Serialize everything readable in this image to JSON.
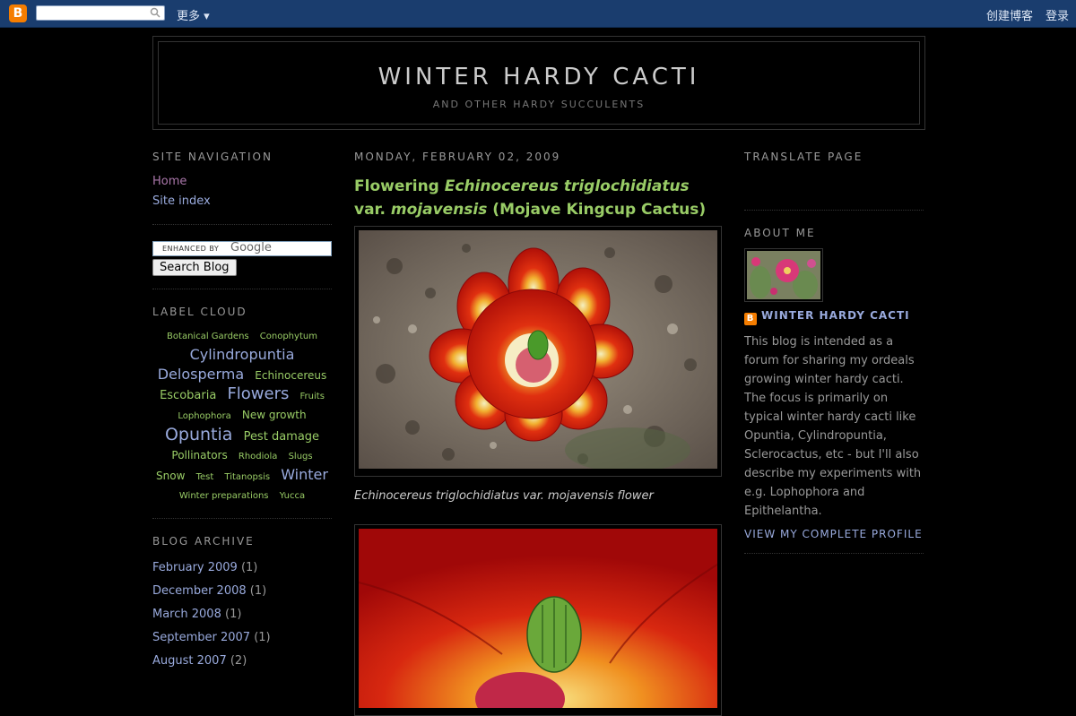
{
  "navbar": {
    "logo_letter": "B",
    "search_value": "",
    "more_label": "更多 ▾",
    "create_blog": "创建博客",
    "sign_in": "登录"
  },
  "header": {
    "title": "WINTER HARDY CACTI",
    "description": "AND OTHER HARDY SUCCULENTS"
  },
  "left": {
    "nav_heading": "SITE NAVIGATION",
    "nav_links": [
      "Home",
      "Site index"
    ],
    "search": {
      "enhanced_by": "ENHANCED BY",
      "google": "Google",
      "button": "Search Blog"
    },
    "cloud_heading": "LABEL CLOUD",
    "cloud": [
      {
        "label": "Botanical Gardens",
        "size": 10
      },
      {
        "label": "Conophytum",
        "size": 10
      },
      {
        "label": "Cylindropuntia",
        "size": 16
      },
      {
        "label": "Delosperma",
        "size": 16
      },
      {
        "label": "Echinocereus",
        "size": 12
      },
      {
        "label": "Escobaria",
        "size": 13
      },
      {
        "label": "Flowers",
        "size": 18
      },
      {
        "label": "Fruits",
        "size": 10
      },
      {
        "label": "Lophophora",
        "size": 10
      },
      {
        "label": "New growth",
        "size": 12
      },
      {
        "label": "Opuntia",
        "size": 19
      },
      {
        "label": "Pest damage",
        "size": 13
      },
      {
        "label": "Pollinators",
        "size": 12
      },
      {
        "label": "Rhodiola",
        "size": 10
      },
      {
        "label": "Slugs",
        "size": 10
      },
      {
        "label": "Snow",
        "size": 12
      },
      {
        "label": "Test",
        "size": 10
      },
      {
        "label": "Titanopsis",
        "size": 10
      },
      {
        "label": "Winter",
        "size": 16
      },
      {
        "label": "Winter preparations",
        "size": 10
      },
      {
        "label": "Yucca",
        "size": 10
      }
    ],
    "archive_heading": "BLOG ARCHIVE",
    "archive": [
      {
        "month": "February 2009",
        "count": "(1)"
      },
      {
        "month": "December 2008",
        "count": "(1)"
      },
      {
        "month": "March 2008",
        "count": "(1)"
      },
      {
        "month": "September 2007",
        "count": "(1)"
      },
      {
        "month": "August 2007",
        "count": "(2)"
      }
    ]
  },
  "post": {
    "date": "MONDAY, FEBRUARY 02, 2009",
    "title_1": "Flowering ",
    "title_2": "Echinocereus triglochidiatus",
    "title_3": " var. ",
    "title_4": "mojavensis",
    "title_5": " (Mojave Kingcup Cactus)",
    "caption": "Echinocereus triglochidiatus var. mojavensis flower"
  },
  "right": {
    "translate_heading": "TRANSLATE PAGE",
    "about_heading": "ABOUT ME",
    "profile_name": "WINTER HARDY CACTI",
    "about_text": "This blog is intended as a forum for sharing my ordeals growing winter hardy cacti. The focus is primarily on typical winter hardy cacti like Opuntia, Cylindropuntia, Sclerocactus, etc - but I'll also describe my experiments with e.g. Lophophora and Epithelantha.",
    "view_profile": "VIEW MY COMPLETE PROFILE"
  },
  "colors": {
    "background": "#000000",
    "navbar": "#1a3d6e",
    "link": "#99aadd",
    "post_title": "#99cc66",
    "heading": "#999999",
    "blogger_orange": "#f57d00"
  }
}
